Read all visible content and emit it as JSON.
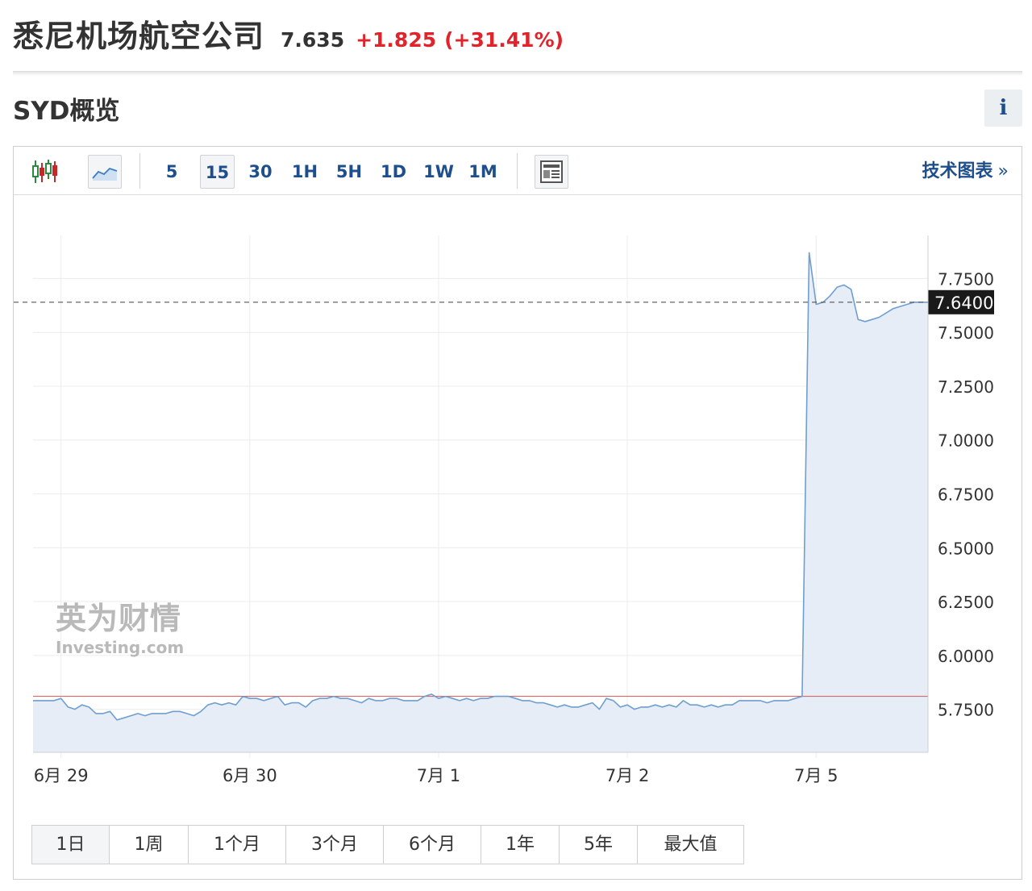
{
  "header": {
    "company_name": "悉尼机场航空公司",
    "price": "7.635",
    "change": "+1.825",
    "change_pct": "(+31.41%)"
  },
  "overview": {
    "title": "SYD概览",
    "info_label": "i"
  },
  "toolbar": {
    "chart_type_icons": [
      "candlestick-chart-icon",
      "area-chart-icon"
    ],
    "intervals": [
      "5",
      "15",
      "30",
      "1H",
      "5H",
      "1D",
      "1W",
      "1M"
    ],
    "active_interval": "15",
    "news_icon": "news-overlay-icon",
    "tech_chart_label": "技术图表",
    "tech_chart_arrow": "»"
  },
  "range_buttons": [
    "1日",
    "1周",
    "1个月",
    "3个月",
    "6个月",
    "1年",
    "5年",
    "最大值"
  ],
  "watermark": {
    "cn": "英为财情",
    "en": "Investing.com"
  },
  "colors": {
    "line": "#6e9fcf",
    "area": "#e7edf7",
    "change_up": "#e0242c",
    "prev_close_line": "#e06666",
    "link_blue": "#1e4f8c"
  },
  "chart_data": {
    "type": "area",
    "x_tick_labels": [
      "6月 29",
      "6月 30",
      "7月 1",
      "7月 2",
      "7月 5"
    ],
    "y_tick_labels": [
      "7.7500",
      "7.5000",
      "7.2500",
      "7.0000",
      "6.7500",
      "6.5000",
      "6.2500",
      "6.0000",
      "5.7500"
    ],
    "ylim": [
      5.55,
      7.95
    ],
    "current_price_label": "7.6400",
    "current_price": 7.64,
    "previous_close": 5.81,
    "grid": true,
    "series": [
      {
        "values": [
          5.79,
          5.79,
          5.79,
          5.79,
          5.8,
          5.76,
          5.75,
          5.77,
          5.76,
          5.73,
          5.73,
          5.74,
          5.7,
          5.71,
          5.72,
          5.73,
          5.72,
          5.73,
          5.73,
          5.73,
          5.74,
          5.74,
          5.73,
          5.72,
          5.74,
          5.77,
          5.78,
          5.77,
          5.78,
          5.77,
          5.81,
          5.8,
          5.8,
          5.79,
          5.8,
          5.81,
          5.77,
          5.78,
          5.78,
          5.76,
          5.79,
          5.8,
          5.8,
          5.81,
          5.8,
          5.8,
          5.79,
          5.78,
          5.8,
          5.79,
          5.79,
          5.8,
          5.8,
          5.79,
          5.79,
          5.79,
          5.81,
          5.82,
          5.8,
          5.81,
          5.8,
          5.79,
          5.8,
          5.79,
          5.8,
          5.8,
          5.81,
          5.81,
          5.81,
          5.8,
          5.79,
          5.79,
          5.78,
          5.78,
          5.77,
          5.76,
          5.77,
          5.76,
          5.76,
          5.77,
          5.78,
          5.75,
          5.8,
          5.79,
          5.76,
          5.77,
          5.75,
          5.76,
          5.76,
          5.77,
          5.76,
          5.77,
          5.76,
          5.79,
          5.77,
          5.77,
          5.76,
          5.77,
          5.76,
          5.77,
          5.77,
          5.79,
          5.79,
          5.79,
          5.79,
          5.78,
          5.79,
          5.79,
          5.79,
          5.8,
          5.81,
          7.87,
          7.63,
          7.64,
          7.67,
          7.71,
          7.72,
          7.7,
          7.56,
          7.55,
          7.56,
          7.57,
          7.59,
          7.61,
          7.62,
          7.63,
          7.64,
          7.64,
          7.64
        ]
      }
    ]
  }
}
